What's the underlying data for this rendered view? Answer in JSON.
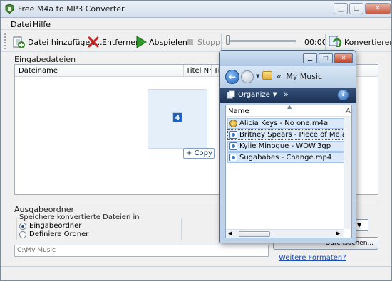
{
  "window": {
    "title": "Free M4a to MP3 Converter"
  },
  "menu": {
    "items": [
      "Datei",
      "Hilfe"
    ]
  },
  "toolbar": {
    "add_label": "Datei hinzufügen...",
    "remove_label": "Entfernen",
    "play_label": "Abspielen",
    "stop_label": "Stopp",
    "time": "00:00",
    "convert_label": "Konvertieren",
    "seek_position": 0
  },
  "input": {
    "section_label": "Eingabedateien",
    "columns": [
      "Dateiname",
      "Titel Nr",
      "Tit"
    ]
  },
  "drag": {
    "count": "4",
    "copy_label": "+ Copy"
  },
  "output": {
    "section_label": "Ausgabeordner",
    "save_in_label": "Speichere konvertierte Dateien in",
    "option_output": "Eingabeordner",
    "option_define": "Definiere Ordner",
    "selected": "Eingabeordner",
    "path": "C:\\My Music",
    "browse_label": "Durchsuchen...",
    "format_caret": "▼",
    "more_formats": "Weitere Formaten?"
  },
  "explorer": {
    "address_sep": "«",
    "address": "My Music",
    "organize_label": "Organize",
    "more": "»",
    "help": "?",
    "column_name": "Name",
    "column_a": "A",
    "files": [
      "Alicia Keys - No one.m4a",
      "Britney Spears - Piece of Me.aac",
      "Kylie Minogue - WOW.3gp",
      "Sugababes - Change.mp4"
    ]
  },
  "colors": {
    "accent": "#1e50b4",
    "selection": "#d9e9fa",
    "command_bar": "#1c3254"
  }
}
